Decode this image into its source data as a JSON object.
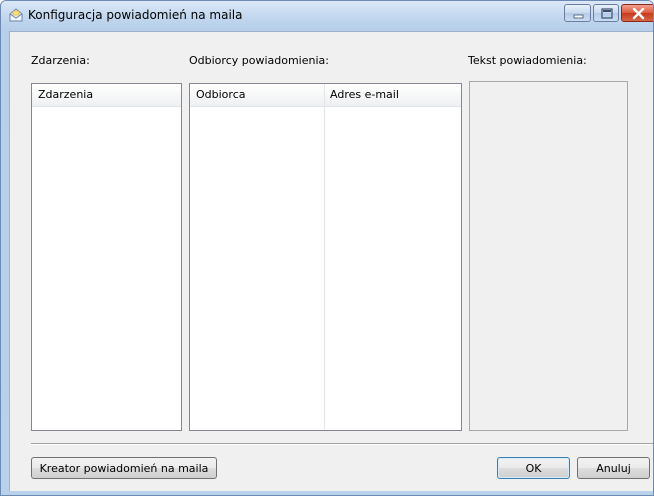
{
  "window": {
    "title": "Konfiguracja powiadomień na maila"
  },
  "panels": {
    "events_label": "Zdarzenia:",
    "recipients_label": "Odbiorcy powiadomienia:",
    "text_label": "Tekst powiadomienia:"
  },
  "events_list": {
    "columns": [
      "Zdarzenia"
    ],
    "rows": []
  },
  "recipients_list": {
    "columns": [
      "Odbiorca",
      "Adres e-mail"
    ],
    "rows": []
  },
  "buttons": {
    "wizard": "Kreator powiadomień na maila",
    "ok": "OK",
    "cancel": "Anuluj"
  },
  "icons": {
    "title": "mail-notification-icon",
    "minimize": "minimize-icon",
    "maximize": "maximize-icon",
    "close": "close-icon"
  }
}
